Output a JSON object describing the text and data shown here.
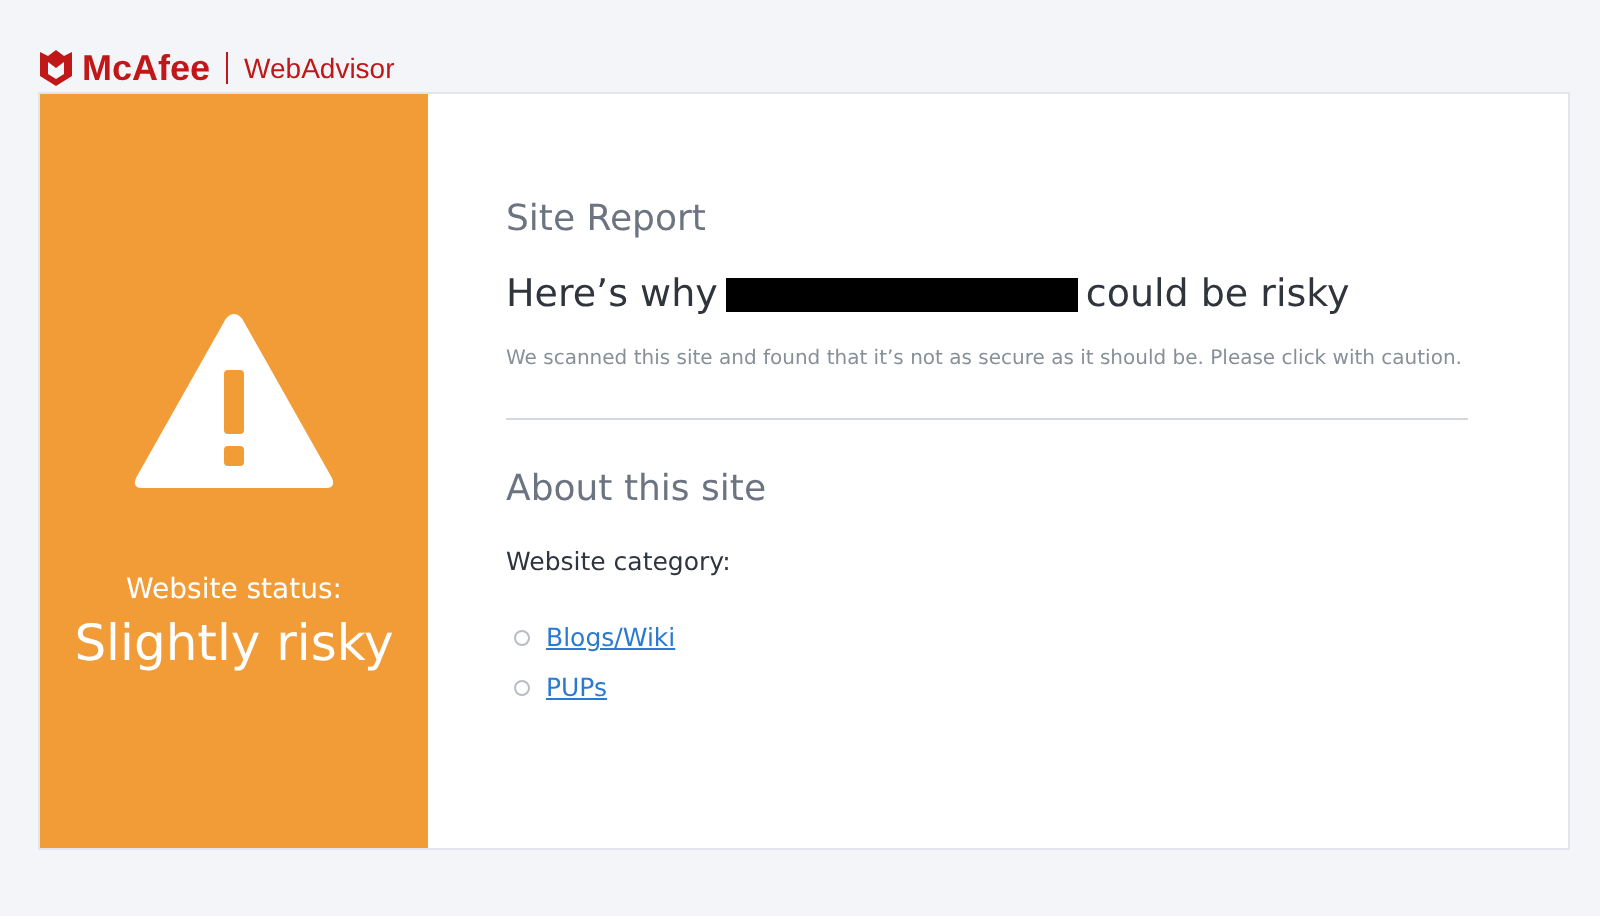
{
  "header": {
    "brand": "McAfee",
    "product": "WebAdvisor"
  },
  "status_panel": {
    "label": "Website status:",
    "status": "Slightly risky"
  },
  "report": {
    "title": "Site Report",
    "heading_before": "Here’s why",
    "heading_after": "could be risky",
    "description": "We scanned this site and found that it’s not as secure as it should be. Please click with caution."
  },
  "about": {
    "title": "About this site",
    "category_label": "Website category:",
    "categories": [
      {
        "label": "Blogs/Wiki"
      },
      {
        "label": "PUPs"
      }
    ]
  }
}
